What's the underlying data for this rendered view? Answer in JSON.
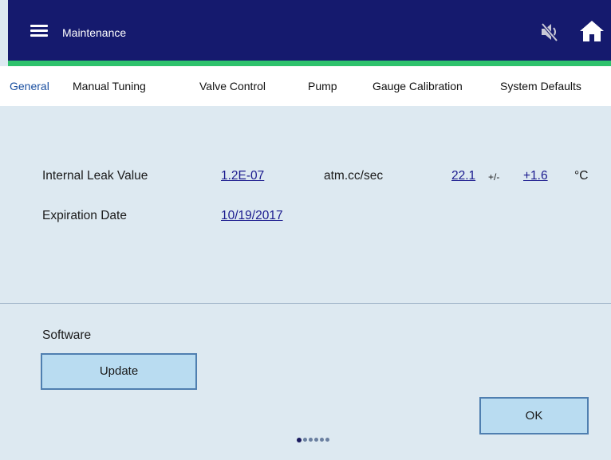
{
  "header": {
    "title": "Maintenance",
    "icons": [
      "menu-icon",
      "mute-icon",
      "home-icon"
    ],
    "colors": {
      "bar": "#151a6e",
      "accent": "#2ec26c"
    }
  },
  "tabs": [
    {
      "label": "General",
      "active": true
    },
    {
      "label": "Manual Tuning"
    },
    {
      "label": "Valve Control"
    },
    {
      "label": "Pump"
    },
    {
      "label": "Gauge Calibration"
    },
    {
      "label": "System Defaults"
    }
  ],
  "leak": {
    "label": "Internal Leak Value",
    "value": "1.2E-07",
    "unit": "atm.cc/sec",
    "temp": "22.1",
    "plus_minus": "+/-",
    "tolerance": "+1.6",
    "temp_unit": "°C"
  },
  "expiration": {
    "label": "Expiration Date",
    "value": "10/19/2017"
  },
  "software": {
    "label": "Software",
    "update_button": "Update"
  },
  "ok_button": "OK",
  "pager": {
    "count": 6,
    "active": 1
  }
}
